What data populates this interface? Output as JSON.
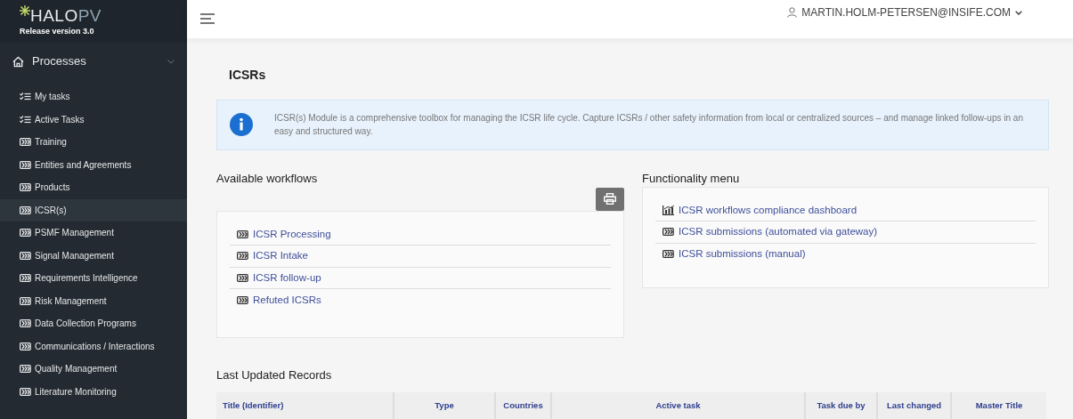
{
  "sidebar": {
    "logo": {
      "brand_a": "HALO",
      "brand_b": "PV"
    },
    "release": "Release version 3.0",
    "section": {
      "label": "Processes",
      "expanded": true
    },
    "items": [
      {
        "kind": "tasks",
        "label": "My tasks",
        "selected": false
      },
      {
        "kind": "tasks",
        "label": "Active Tasks",
        "selected": false
      },
      {
        "kind": "module",
        "label": "Training",
        "selected": false
      },
      {
        "kind": "module",
        "label": "Entities and Agreements",
        "selected": false
      },
      {
        "kind": "module",
        "label": "Products",
        "selected": false
      },
      {
        "kind": "module",
        "label": "ICSR(s)",
        "selected": true
      },
      {
        "kind": "module",
        "label": "PSMF Management",
        "selected": false
      },
      {
        "kind": "module",
        "label": "Signal Management",
        "selected": false
      },
      {
        "kind": "module",
        "label": "Requirements Intelligence",
        "selected": false
      },
      {
        "kind": "module",
        "label": "Risk Management",
        "selected": false
      },
      {
        "kind": "module",
        "label": "Data Collection Programs",
        "selected": false
      },
      {
        "kind": "module",
        "label": "Communications / Interactions",
        "selected": false
      },
      {
        "kind": "module",
        "label": "Quality Management",
        "selected": false
      },
      {
        "kind": "module",
        "label": "Literature Monitoring",
        "selected": false
      }
    ]
  },
  "topbar": {
    "user": "MARTIN.HOLM-PETERSEN@INSIFE.COM"
  },
  "page_title": "ICSRs",
  "info": "ICSR(s) Module is a comprehensive toolbox for managing the ICSR life cycle. Capture ICSRs / other safety information from local or centralized sources – and manage linked follow-ups in an easy and structured way.",
  "workflows": {
    "heading": "Available workflows",
    "items": [
      {
        "kind": "module",
        "label": "ICSR Processing"
      },
      {
        "kind": "module",
        "label": "ICSR Intake"
      },
      {
        "kind": "module",
        "label": "ICSR follow-up"
      },
      {
        "kind": "module",
        "label": "Refuted ICSRs"
      }
    ]
  },
  "functionality": {
    "heading": "Functionality menu",
    "items": [
      {
        "kind": "chart",
        "label": "ICSR workflows compliance dashboard"
      },
      {
        "kind": "module",
        "label": "ICSR submissions (automated via gateway)"
      },
      {
        "kind": "module",
        "label": "ICSR submissions (manual)"
      }
    ]
  },
  "records": {
    "heading": "Last Updated Records",
    "columns": [
      "Title (Identifier)",
      "Type",
      "Countries",
      "Active task",
      "Task due by",
      "Last changed",
      "Master Title"
    ]
  }
}
